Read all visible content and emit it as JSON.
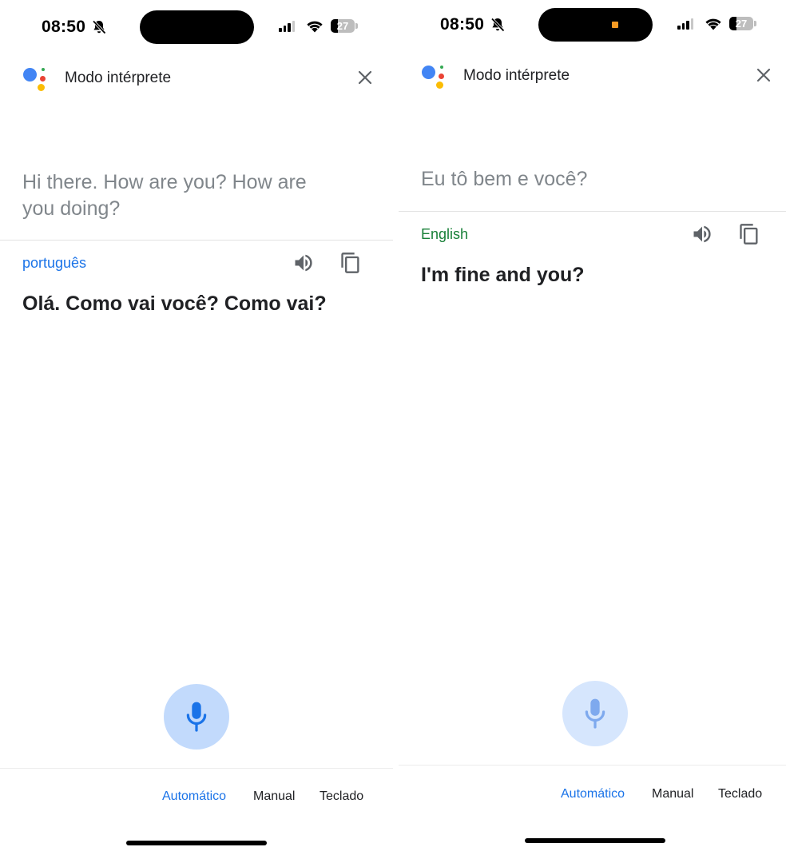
{
  "left": {
    "status": {
      "time": "08:50",
      "battery": "27"
    },
    "header": {
      "title": "Modo intérprete"
    },
    "source_text": "Hi there. How are you? How are you doing?",
    "target_language": "português",
    "translation": "Olá. Como vai você? Como vai?",
    "modes": {
      "auto": "Automático",
      "manual": "Manual",
      "keyboard": "Teclado",
      "active": "auto"
    }
  },
  "right": {
    "status": {
      "time": "08:50",
      "battery": "27"
    },
    "header": {
      "title": "Modo intérprete"
    },
    "source_text": "Eu tô bem e você?",
    "target_language": "English",
    "translation": "I'm fine and you?",
    "modes": {
      "auto": "Automático",
      "manual": "Manual",
      "keyboard": "Teclado",
      "active": "auto"
    }
  },
  "colors": {
    "google_blue": "#4285f4",
    "google_red": "#ea4335",
    "google_yellow": "#fbbc04",
    "google_green": "#34a853",
    "active_mode": "#1a73e8",
    "language_left": "#1a73e8",
    "language_right": "#188038",
    "mic_bg_active": "#c2dafc",
    "mic_bg_idle": "#d6e6fd",
    "recording_indicator": "#f59a23"
  },
  "icons": [
    "mute-bell-icon",
    "cellular-signal-icon",
    "wifi-icon",
    "battery-icon",
    "google-assistant-icon",
    "close-icon",
    "speaker-icon",
    "copy-icon",
    "microphone-icon"
  ]
}
